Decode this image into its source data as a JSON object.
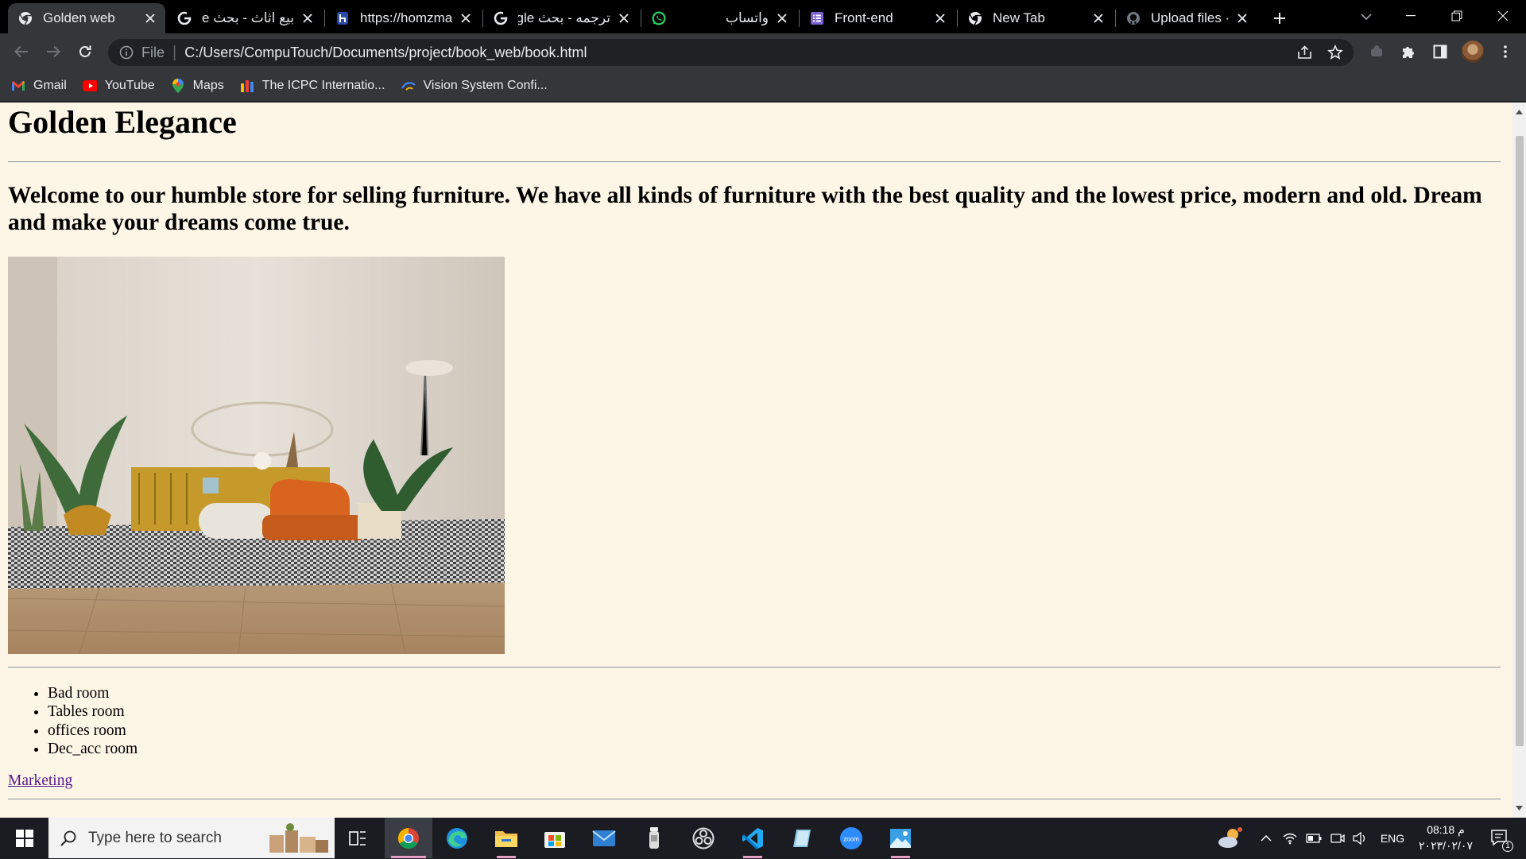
{
  "browser": {
    "tabs": [
      {
        "title": "Golden web",
        "icon": "chrome-icon",
        "active": true
      },
      {
        "title": "بيع اثاث - بحث gle",
        "icon": "google-icon",
        "rtl": true
      },
      {
        "title": "https://homzmart",
        "icon": "homzmart-icon"
      },
      {
        "title": "ترجمه - بحث ogle",
        "icon": "google-icon",
        "rtl": true
      },
      {
        "title": "واتساب",
        "icon": "whatsapp-icon",
        "rtl": true
      },
      {
        "title": "Front-end",
        "icon": "doc-list-icon"
      },
      {
        "title": "New Tab",
        "icon": "chrome-icon"
      },
      {
        "title": "Upload files · kari",
        "icon": "github-icon"
      }
    ],
    "address": {
      "scheme_label": "File",
      "url": "C:/Users/CompuTouch/Documents/project/book_web/book.html"
    },
    "bookmarks": [
      {
        "label": "Gmail",
        "icon": "gmail-icon"
      },
      {
        "label": "YouTube",
        "icon": "youtube-icon"
      },
      {
        "label": "Maps",
        "icon": "maps-icon"
      },
      {
        "label": "The ICPC Internatio...",
        "icon": "icpc-icon"
      },
      {
        "label": "Vision System Confi...",
        "icon": "vision-icon"
      }
    ]
  },
  "page": {
    "title": "Golden Elegance",
    "welcome": "Welcome to our humble store for selling furniture. We have all kinds of furniture with the best quality and the lowest price, modern and old. Dream and make your dreams come true.",
    "rooms": [
      "Bad room",
      "Tables room",
      "offices room",
      "Dec_acc room"
    ],
    "link": "Marketing",
    "background_color": "#fdf5e6"
  },
  "taskbar": {
    "search_placeholder": "Type here to search",
    "language": "ENG",
    "time": "08:18 م",
    "date": "٢٠٢٣/٠٢/٠٧",
    "notification_count": "1"
  }
}
